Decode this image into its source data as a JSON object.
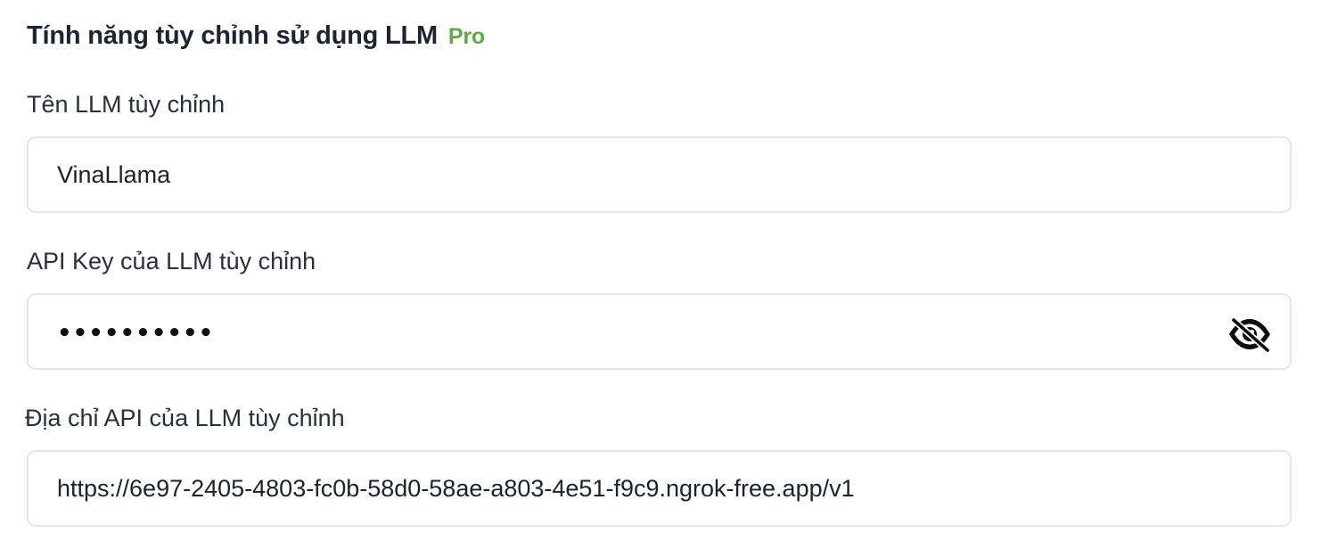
{
  "section": {
    "title": "Tính năng tùy chỉnh sử dụng LLM",
    "badge": "Pro",
    "badge_color": "#5cae43"
  },
  "fields": [
    {
      "label": "Tên LLM tùy chỉnh",
      "value": "VinaLlama"
    },
    {
      "label": "API Key của LLM tùy chỉnh",
      "masked_value": "••••••••••",
      "toggle_icon": "eye-slash-icon"
    },
    {
      "label": "Địa chỉ API của LLM tùy chỉnh",
      "value": "https://6e97-2405-4803-fc0b-58d0-58ae-a803-4e51-f9c9.ngrok-free.app/v1"
    }
  ]
}
